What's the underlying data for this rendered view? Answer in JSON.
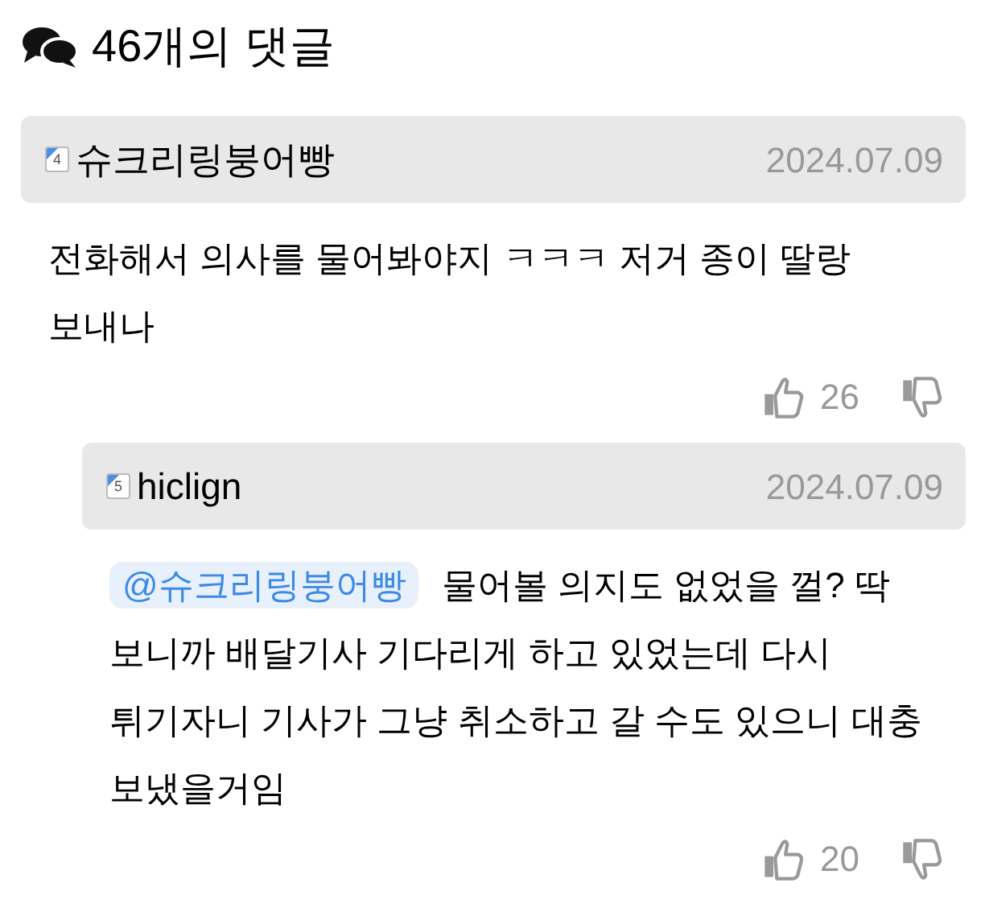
{
  "header": {
    "title": "46개의 댓글"
  },
  "comments": [
    {
      "level_badge": "4",
      "author": "슈크리링붕어빵",
      "date": "2024.07.09",
      "text": "전화해서 의사를 물어봐야지 ㅋㅋㅋ 저거 종이 딸랑 보내나",
      "likes": "26",
      "replies": [
        {
          "level_badge": "5",
          "author": "hiclign",
          "date": "2024.07.09",
          "mention": "@슈크리링붕어빵",
          "text": "물어볼 의지도 없었을 껄? 딱 보니까 배달기사 기다리게 하고 있었는데 다시 튀기자니 기사가 그냥 취소하고 갈 수도 있으니 대충 보냈을거임",
          "likes": "20"
        }
      ]
    }
  ]
}
